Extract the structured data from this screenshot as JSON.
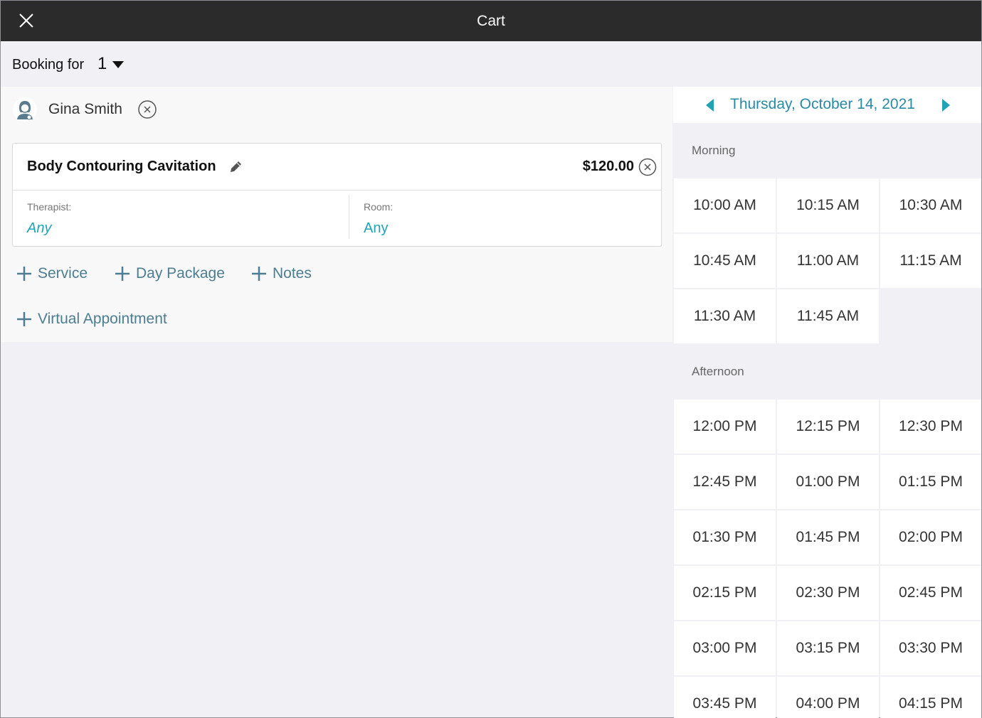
{
  "header": {
    "title": "Cart",
    "close_icon": "close-icon"
  },
  "booking": {
    "label": "Booking for",
    "count": "1"
  },
  "client": {
    "name": "Gina Smith"
  },
  "service_card": {
    "name": "Body Contouring Cavitation",
    "price": "$120.00",
    "therapist_label": "Therapist:",
    "therapist_value": "Any",
    "room_label": "Room:",
    "room_value": "Any"
  },
  "actions": {
    "service": "Service",
    "day_package": "Day Package",
    "notes": "Notes",
    "virtual_appointment": "Virtual Appointment"
  },
  "calendar": {
    "date": "Thursday, October 14, 2021",
    "accent": "#2a8aa6",
    "morning_label": "Morning",
    "afternoon_label": "Afternoon",
    "morning_slots": [
      "10:00 AM",
      "10:15 AM",
      "10:30 AM",
      "10:45 AM",
      "11:00 AM",
      "11:15 AM",
      "11:30 AM",
      "11:45 AM"
    ],
    "afternoon_slots": [
      "12:00 PM",
      "12:15 PM",
      "12:30 PM",
      "12:45 PM",
      "01:00 PM",
      "01:15 PM",
      "01:30 PM",
      "01:45 PM",
      "02:00 PM",
      "02:15 PM",
      "02:30 PM",
      "02:45 PM",
      "03:00 PM",
      "03:15 PM",
      "03:30 PM",
      "03:45 PM",
      "04:00 PM",
      "04:15 PM"
    ]
  }
}
